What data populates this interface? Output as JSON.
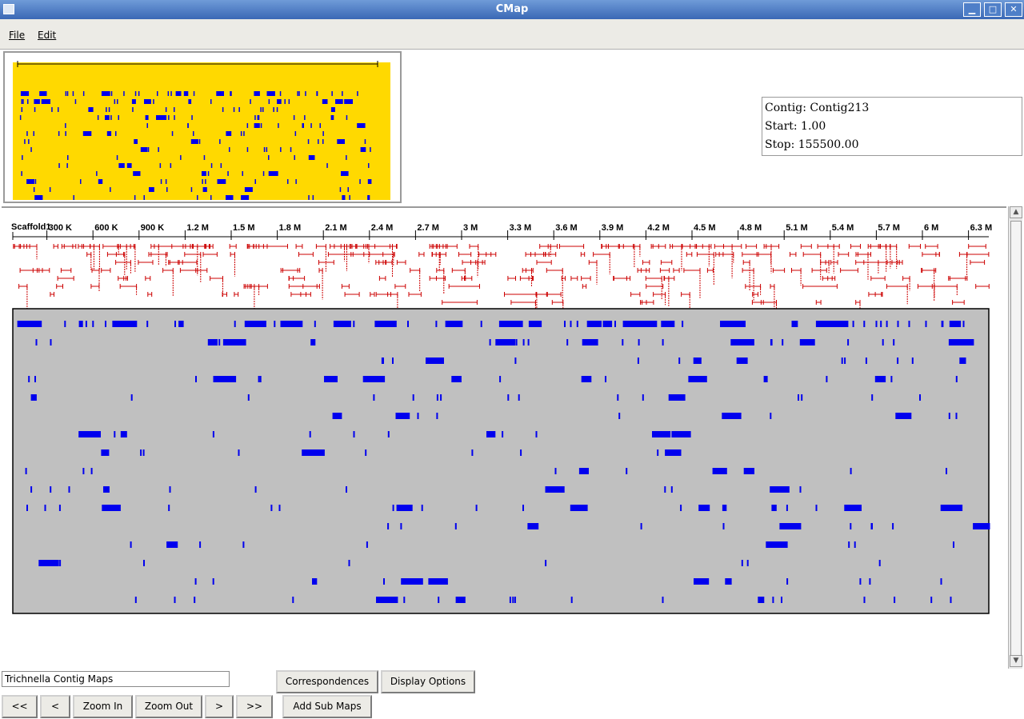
{
  "window": {
    "title": "CMap"
  },
  "menu": {
    "file": "File",
    "edit": "Edit"
  },
  "info": {
    "contig": "Contig: Contig213",
    "start": "Start: 1.00",
    "stop": "Stop: 155500.00"
  },
  "scaffold": {
    "name": "Scaffold1",
    "ticks": [
      "300 K",
      "600 K",
      "900 K",
      "1.2 M",
      "1.5 M",
      "1.8 M",
      "2.1 M",
      "2.4 M",
      "2.7 M",
      "3 M",
      "3.3 M",
      "3.6 M",
      "3.9 M",
      "4.2 M",
      "4.5 M",
      "4.8 M",
      "5.1 M",
      "5.4 M",
      "5.7 M",
      "6 M",
      "6.3 M"
    ]
  },
  "colors": {
    "overview_bg": "#ffd900",
    "panel_bg": "#c0c0c0",
    "contig_blue": "#0000ee",
    "read_red": "#cc0000",
    "titlebar": "#3a68b5"
  },
  "map_name": "Trichnella Contig Maps",
  "buttons": {
    "first": "<<",
    "prev": "<",
    "zoom_in": "Zoom In",
    "zoom_out": "Zoom Out",
    "next": ">",
    "last": ">>",
    "correspondences": "Correspondences",
    "display_options": "Display Options",
    "add_sub_maps": "Add Sub Maps"
  }
}
